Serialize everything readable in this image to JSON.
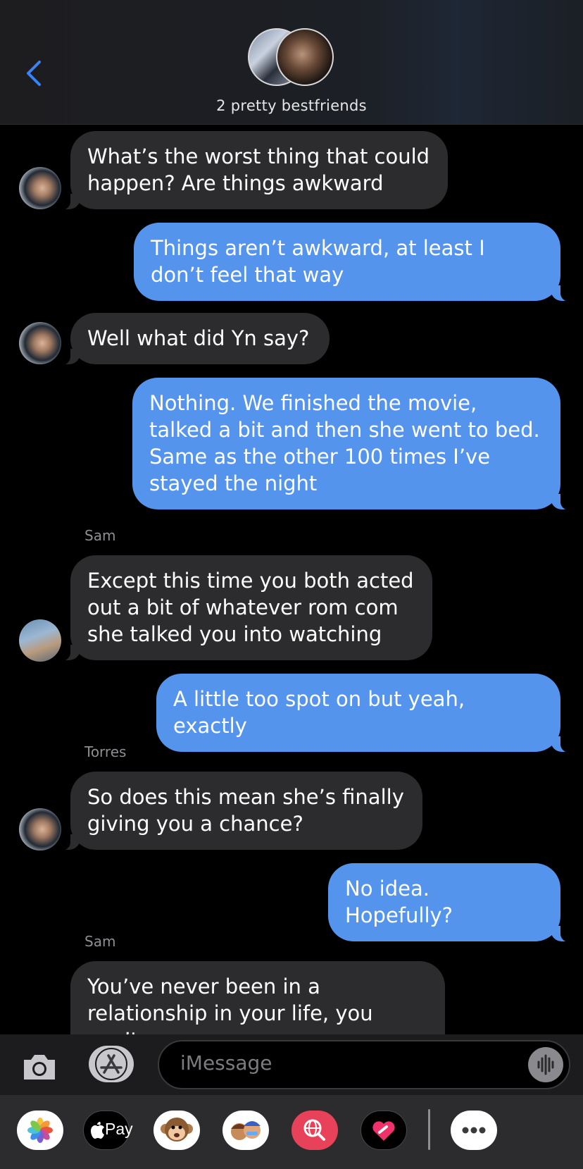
{
  "header": {
    "group_name": "2 pretty bestfriends"
  },
  "messages": [
    {
      "direction": "incoming",
      "sender": "Torres",
      "text": "What’s the worst thing that could happen? Are things awkward"
    },
    {
      "direction": "outgoing",
      "text": "Things aren’t awkward, at least I don’t feel that way"
    },
    {
      "direction": "incoming",
      "sender": "Torres",
      "text": "Well what did Yn say?"
    },
    {
      "direction": "outgoing",
      "text": "Nothing. We finished the movie, talked a bit and then she went to bed. Same as the other 100 times I’ve stayed the night"
    },
    {
      "direction": "incoming",
      "sender": "Sam",
      "sender_label": "Sam",
      "text": "Except this time you both acted out a bit of whatever rom com she talked you into watching"
    },
    {
      "direction": "outgoing",
      "text": "A little too spot on but yeah, exactly"
    },
    {
      "direction": "incoming",
      "sender": "Torres",
      "sender_label": "Torres",
      "text": "So does this mean she’s finally giving you a chance?"
    },
    {
      "direction": "outgoing",
      "text": "No idea. Hopefully?"
    },
    {
      "direction": "incoming",
      "sender": "Sam",
      "sender_label": "Sam",
      "text": "You’ve never been in a relationship in your life, you can’t"
    }
  ],
  "composer": {
    "placeholder": "iMessage"
  },
  "app_strip": {
    "apple_pay_label": "Pay",
    "apps": [
      "photos-app",
      "apple-pay-app",
      "animoji-app",
      "memoji-app",
      "images-search-app",
      "digital-touch-app",
      "more-apps"
    ]
  },
  "colors": {
    "outgoing_bubble": "#5494ed",
    "incoming_bubble": "#2c2c2e",
    "accent": "#3a82f7"
  }
}
